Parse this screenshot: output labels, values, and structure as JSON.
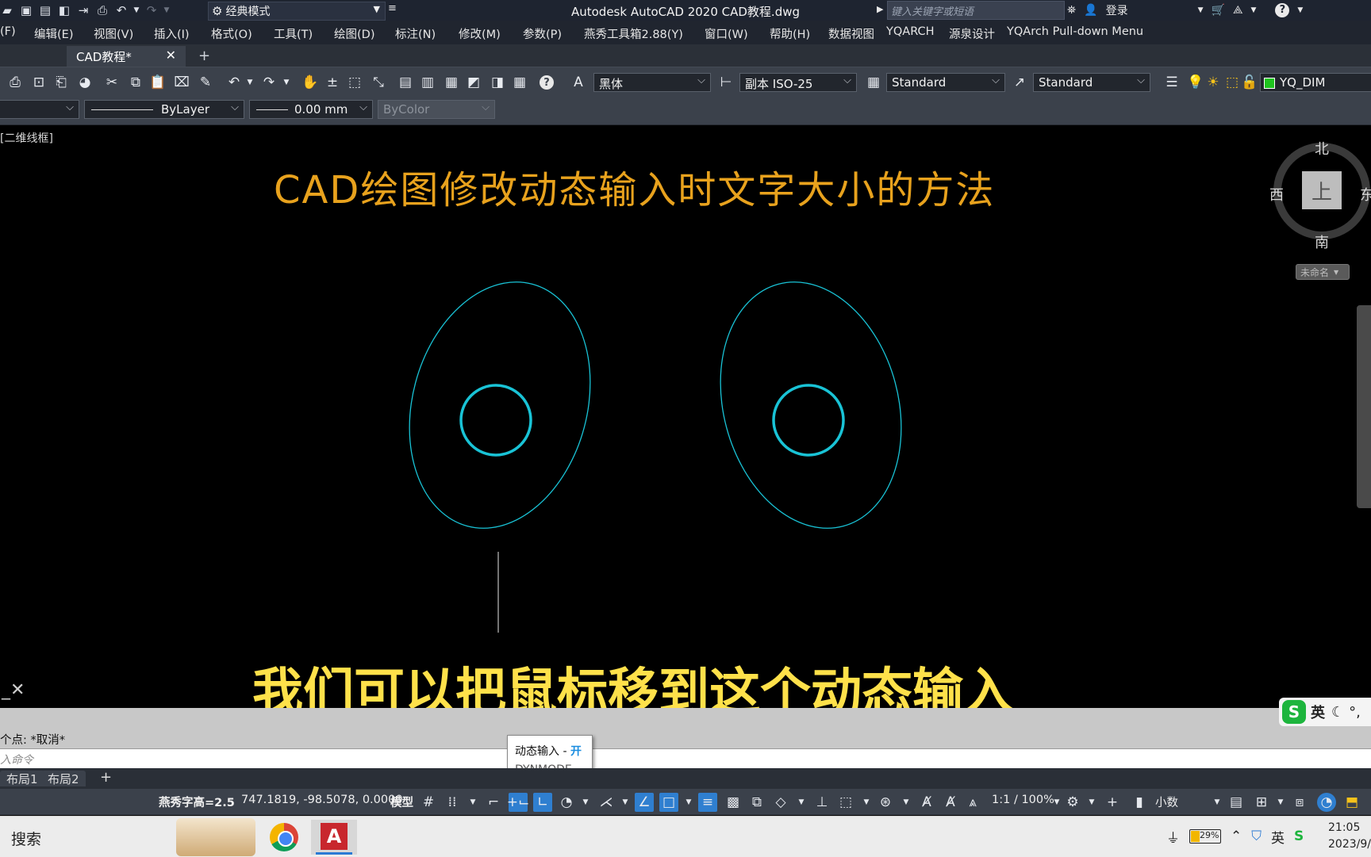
{
  "titlebar": {
    "workspace": "经典模式",
    "app_title": "Autodesk AutoCAD 2020    CAD教程.dwg",
    "search_placeholder": "键入关键字或短语",
    "login": "登录"
  },
  "menu": {
    "items": [
      "(F)",
      "编辑(E)",
      "视图(V)",
      "插入(I)",
      "格式(O)",
      "工具(T)",
      "绘图(D)",
      "标注(N)",
      "修改(M)",
      "参数(P)",
      "燕秀工具箱2.88(Y)",
      "窗口(W)",
      "帮助(H)",
      "数据视图",
      "YQARCH",
      "源泉设计",
      "YQArch Pull-down Menu"
    ]
  },
  "tabs": {
    "active": "CAD教程*"
  },
  "toolbar1": {
    "text_style": "黑体",
    "dim_style": "副本 ISO-25",
    "table_style": "Standard",
    "mleader_style": "Standard",
    "layer": "YQ_DIM",
    "layer_color": "#1ec31e"
  },
  "toolbar2": {
    "linetype": "ByLayer",
    "lineweight": "0.00 mm",
    "plotstyle": "ByColor"
  },
  "canvas": {
    "view_label": "[二维线框]",
    "title": "CAD绘图修改动态输入时文字大小的方法",
    "subtitle": "我们可以把鼠标移到这个动态输入",
    "geometry_color": "#19c3d6"
  },
  "viewcube": {
    "north": "北",
    "south": "南",
    "west": "西",
    "east": "东",
    "face": "上",
    "wcs": "未命名"
  },
  "command": {
    "history": "个点: *取消*",
    "prompt": "入命令"
  },
  "tooltip": {
    "title": "动态输入",
    "state": "开",
    "command": "DYNMODE"
  },
  "ime": {
    "lang": "英"
  },
  "layout_tabs": [
    "布局1",
    "布局2"
  ],
  "statusbar": {
    "text_height": "燕秀字高=2.5",
    "coords": "747.1819, -98.5078, 0.0000",
    "model": "模型",
    "scale": "1:1 / 100%",
    "units": "小数"
  },
  "taskbar": {
    "search": "搜索",
    "battery": "29%",
    "ime": "英",
    "time": "21:05",
    "date": "2023/9/"
  }
}
